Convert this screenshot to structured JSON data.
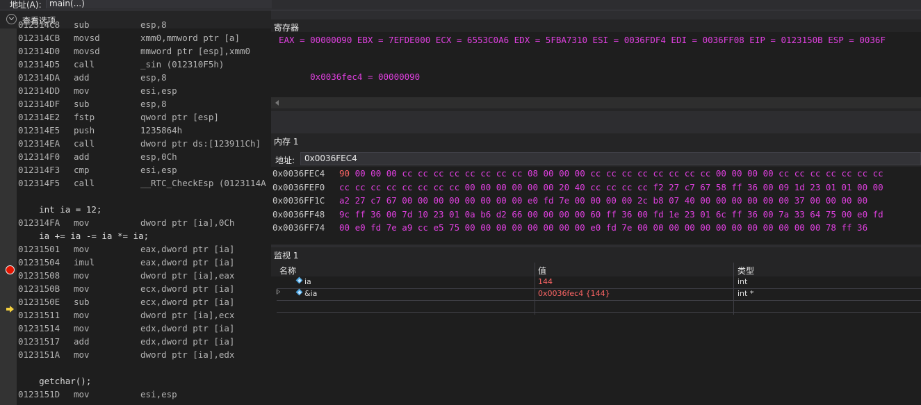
{
  "address_bar": {
    "label": "地址(A):",
    "value": "main(...)"
  },
  "disassembly": {
    "view_options_label": "查看选项",
    "lines": [
      {
        "addr": "012314C8",
        "op": "sub",
        "args": "esp,8"
      },
      {
        "addr": "012314CB",
        "op": "movsd",
        "args": "xmm0,mmword ptr [a]"
      },
      {
        "addr": "012314D0",
        "op": "movsd",
        "args": "mmword ptr [esp],xmm0"
      },
      {
        "addr": "012314D5",
        "op": "call",
        "args": "_sin (012310F5h)"
      },
      {
        "addr": "012314DA",
        "op": "add",
        "args": "esp,8"
      },
      {
        "addr": "012314DD",
        "op": "mov",
        "args": "esi,esp"
      },
      {
        "addr": "012314DF",
        "op": "sub",
        "args": "esp,8"
      },
      {
        "addr": "012314E2",
        "op": "fstp",
        "args": "qword ptr [esp]"
      },
      {
        "addr": "012314E5",
        "op": "push",
        "args": "1235864h"
      },
      {
        "addr": "012314EA",
        "op": "call",
        "args": "dword ptr ds:[123911Ch]"
      },
      {
        "addr": "012314F0",
        "op": "add",
        "args": "esp,0Ch"
      },
      {
        "addr": "012314F3",
        "op": "cmp",
        "args": "esi,esp"
      },
      {
        "addr": "012314F5",
        "op": "call",
        "args": "__RTC_CheckEsp (0123114A"
      },
      {
        "addr": "",
        "op": "",
        "args": ""
      },
      {
        "source": "    int ia = 12;"
      },
      {
        "addr": "012314FA",
        "op": "mov",
        "args": "dword ptr [ia],0Ch"
      },
      {
        "source": "    ia += ia -= ia *= ia;"
      },
      {
        "addr": "01231501",
        "op": "mov",
        "args": "eax,dword ptr [ia]",
        "breakpoint": true
      },
      {
        "addr": "01231504",
        "op": "imul",
        "args": "eax,dword ptr [ia]"
      },
      {
        "addr": "01231508",
        "op": "mov",
        "args": "dword ptr [ia],eax"
      },
      {
        "addr": "0123150B",
        "op": "mov",
        "args": "ecx,dword ptr [ia]",
        "current": true
      },
      {
        "addr": "0123150E",
        "op": "sub",
        "args": "ecx,dword ptr [ia]"
      },
      {
        "addr": "01231511",
        "op": "mov",
        "args": "dword ptr [ia],ecx"
      },
      {
        "addr": "01231514",
        "op": "mov",
        "args": "edx,dword ptr [ia]"
      },
      {
        "addr": "01231517",
        "op": "add",
        "args": "edx,dword ptr [ia]"
      },
      {
        "addr": "0123151A",
        "op": "mov",
        "args": "dword ptr [ia],edx"
      },
      {
        "addr": "",
        "op": "",
        "args": ""
      },
      {
        "source": "    getchar();"
      },
      {
        "addr": "0123151D",
        "op": "mov",
        "args": "esi,esp"
      }
    ]
  },
  "registers": {
    "title": "寄存器",
    "line1": "EAX = 00000090 EBX = 7EFDE000 ECX = 6553C0A6 EDX = 5FBA7310 ESI = 0036FDF4 EDI = 0036FF08 EIP = 0123150B ESP = 0036F",
    "line2": "0x0036fec4 = 00000090"
  },
  "memory": {
    "title": "内存 1",
    "address_label": "地址:",
    "address_value": "0x0036FEC4",
    "rows": [
      {
        "addr": "0x0036FEC4",
        "first": "90",
        "bytes": "00 00 00 cc cc cc cc cc cc cc cc 08 00 00 00 cc cc cc cc cc cc cc cc 00 00 00 00 cc cc cc cc cc cc cc"
      },
      {
        "addr": "0x0036FEF0",
        "first": "",
        "bytes": "cc cc cc cc cc cc cc cc 00 00 00 00 00 00 20 40 cc cc cc cc f2 27 c7 67 58 ff 36 00 09 1d 23 01 01 00 00"
      },
      {
        "addr": "0x0036FF1C",
        "first": "",
        "bytes": "a2 27 c7 67 00 00 00 00 00 00 00 00 e0 fd 7e 00 00 00 00 2c b8 07 40 00 00 00 00 00 00 37 00 00 00 00"
      },
      {
        "addr": "0x0036FF48",
        "first": "",
        "bytes": "9c ff 36 00 7d 10 23 01 0a b6 d2 66 00 00 00 00 60 ff 36 00 fd 1e 23 01 6c ff 36 00 7a 33 64 75 00 e0 fd"
      },
      {
        "addr": "0x0036FF74",
        "first": "",
        "bytes": "00 e0 fd 7e a9 cc e5 75 00 00 00 00 00 00 00 00 e0 fd 7e 00 00 00 00 00 00 00 00 00 00 00 00 78 ff 36"
      }
    ]
  },
  "watch": {
    "title": "监视 1",
    "columns": {
      "name": "名称",
      "value": "值",
      "type": "类型"
    },
    "rows": [
      {
        "name": "ia",
        "value": "144",
        "type": "int",
        "expandable": false
      },
      {
        "name": "&ia",
        "value": "0x0036fec4 {144}",
        "type": "int *",
        "expandable": true
      }
    ]
  }
}
